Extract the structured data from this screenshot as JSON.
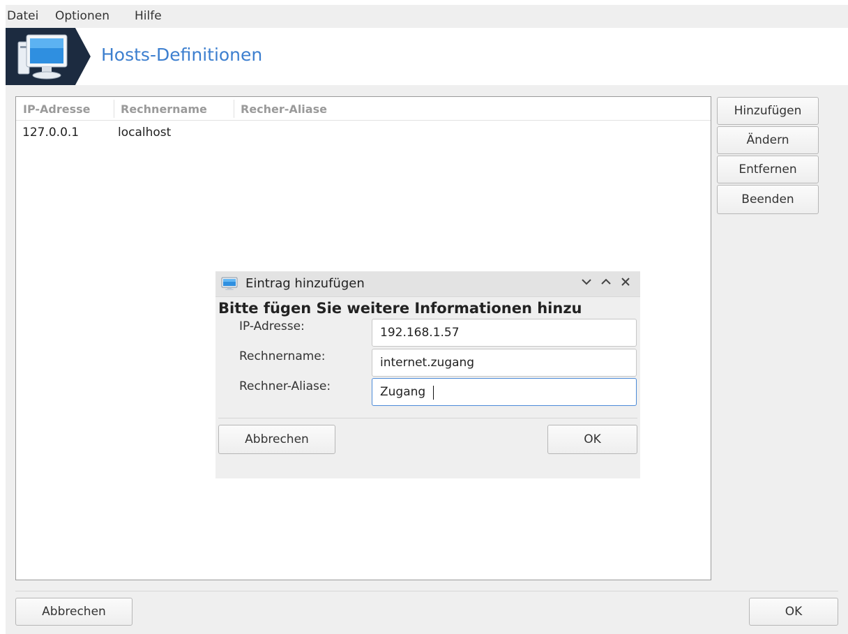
{
  "menu": {
    "items": [
      "Datei",
      "Optionen",
      "Hilfe"
    ]
  },
  "banner": {
    "title": "Hosts-Definitionen",
    "icon": "computer-monitor-icon"
  },
  "table": {
    "columns": [
      "IP-Adresse",
      "Rechnername",
      "Recher-Aliase"
    ],
    "rows": [
      [
        "127.0.0.1",
        "localhost",
        ""
      ]
    ]
  },
  "side_buttons": {
    "add": "Hinzufügen",
    "edit": "Ändern",
    "remove": "Entfernen",
    "quit": "Beenden"
  },
  "footer": {
    "cancel": "Abbrechen",
    "ok": "OK"
  },
  "dialog": {
    "title": "Eintrag hinzufügen",
    "heading": "Bitte fügen Sie weitere Informationen hinzu",
    "fields": {
      "ip_label": "IP-Adresse:",
      "ip_value": "192.168.1.57",
      "host_label": "Rechnername:",
      "host_value": "internet.zugang",
      "alias_label": "Rechner-Aliase:",
      "alias_value": "Zugang"
    },
    "cancel": "Abbrechen",
    "ok": "OK",
    "controls": [
      "chevron-down-icon",
      "chevron-up-icon",
      "close-icon"
    ]
  },
  "colors": {
    "accent": "#3d7fcf",
    "focus_border": "#4a8ad8",
    "banner_dark": "#1c2b40"
  }
}
